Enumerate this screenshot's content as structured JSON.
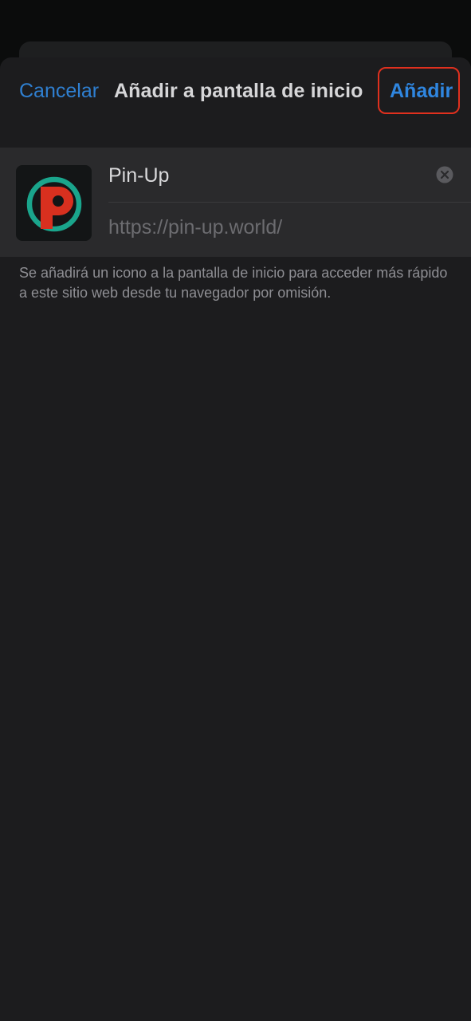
{
  "header": {
    "cancel_label": "Cancelar",
    "title": "Añadir a pantalla de inicio",
    "add_label": "Añadir"
  },
  "bookmark": {
    "name_value": "Pin-Up",
    "url": "https://pin-up.world/",
    "icon_name": "pin-up-logo-icon",
    "clear_icon_name": "clear-text-icon"
  },
  "footer_note": "Se añadirá un icono a la pantalla de inicio para acceder más rápido a este sitio web desde tu navegador por omisión.",
  "colors": {
    "accent": "#2f86e0",
    "highlight": "#e0301e",
    "logo_red": "#d8301f",
    "logo_teal": "#1aa58c"
  }
}
